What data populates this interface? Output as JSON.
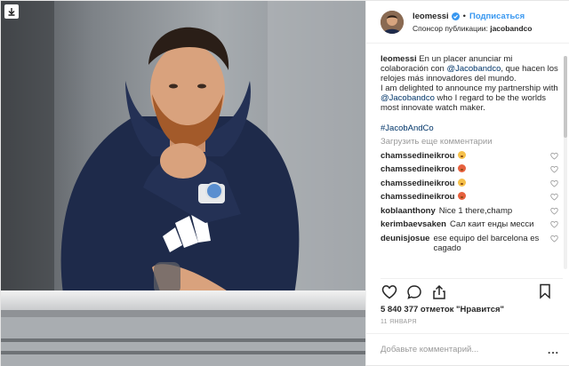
{
  "post": {
    "username": "leomessi",
    "follow_label": "Подписаться",
    "dot": "•",
    "sponsor_prefix": "Спонсор публикации:",
    "sponsor_name": "jacobandco",
    "caption": {
      "username": "leomessi",
      "text_part1": " En un placer anunciar mi colaboración con ",
      "mention1": "@Jacobandco",
      "text_part2": ", que hacen los relojes más innovadores del mundo.",
      "text_part3": "I am delighted to announce my partnership with ",
      "mention2": "@Jacobandco",
      "text_part4": " who I regard to be the worlds most innovate watch maker."
    },
    "hashtag": "#JacobAndCo",
    "load_more": "Загрузить еще комментарии",
    "comments": [
      {
        "user": "chamssedineikrou",
        "text": "",
        "emoji": "yellow"
      },
      {
        "user": "chamssedineikrou",
        "text": "",
        "emoji": "red"
      },
      {
        "user": "chamssedineikrou",
        "text": "",
        "emoji": "yellow"
      },
      {
        "user": "chamssedineikrou",
        "text": "",
        "emoji": "red"
      },
      {
        "user": "koblaanthony",
        "text": "Nice 1 there,champ",
        "emoji": ""
      },
      {
        "user": "kerimbaevsaken",
        "text": "Сал каит енды месси",
        "emoji": ""
      },
      {
        "user": "deunisjosue",
        "text": "ese equipo del barcelona es cagado",
        "emoji": ""
      }
    ],
    "likes": "5 840 377 отметок \"Нравится\"",
    "date": "11 января",
    "comment_placeholder": "Добавьте комментарий...",
    "more_label": "..."
  },
  "colors": {
    "accent": "#3897f0",
    "link": "#003569",
    "text": "#262626",
    "muted": "#999999"
  },
  "icons": {
    "download": "download-arrow-icon",
    "verified": "verified-badge-icon",
    "heart": "heart-icon",
    "comment": "comment-bubble-icon",
    "share": "share-icon",
    "bookmark": "bookmark-icon"
  }
}
